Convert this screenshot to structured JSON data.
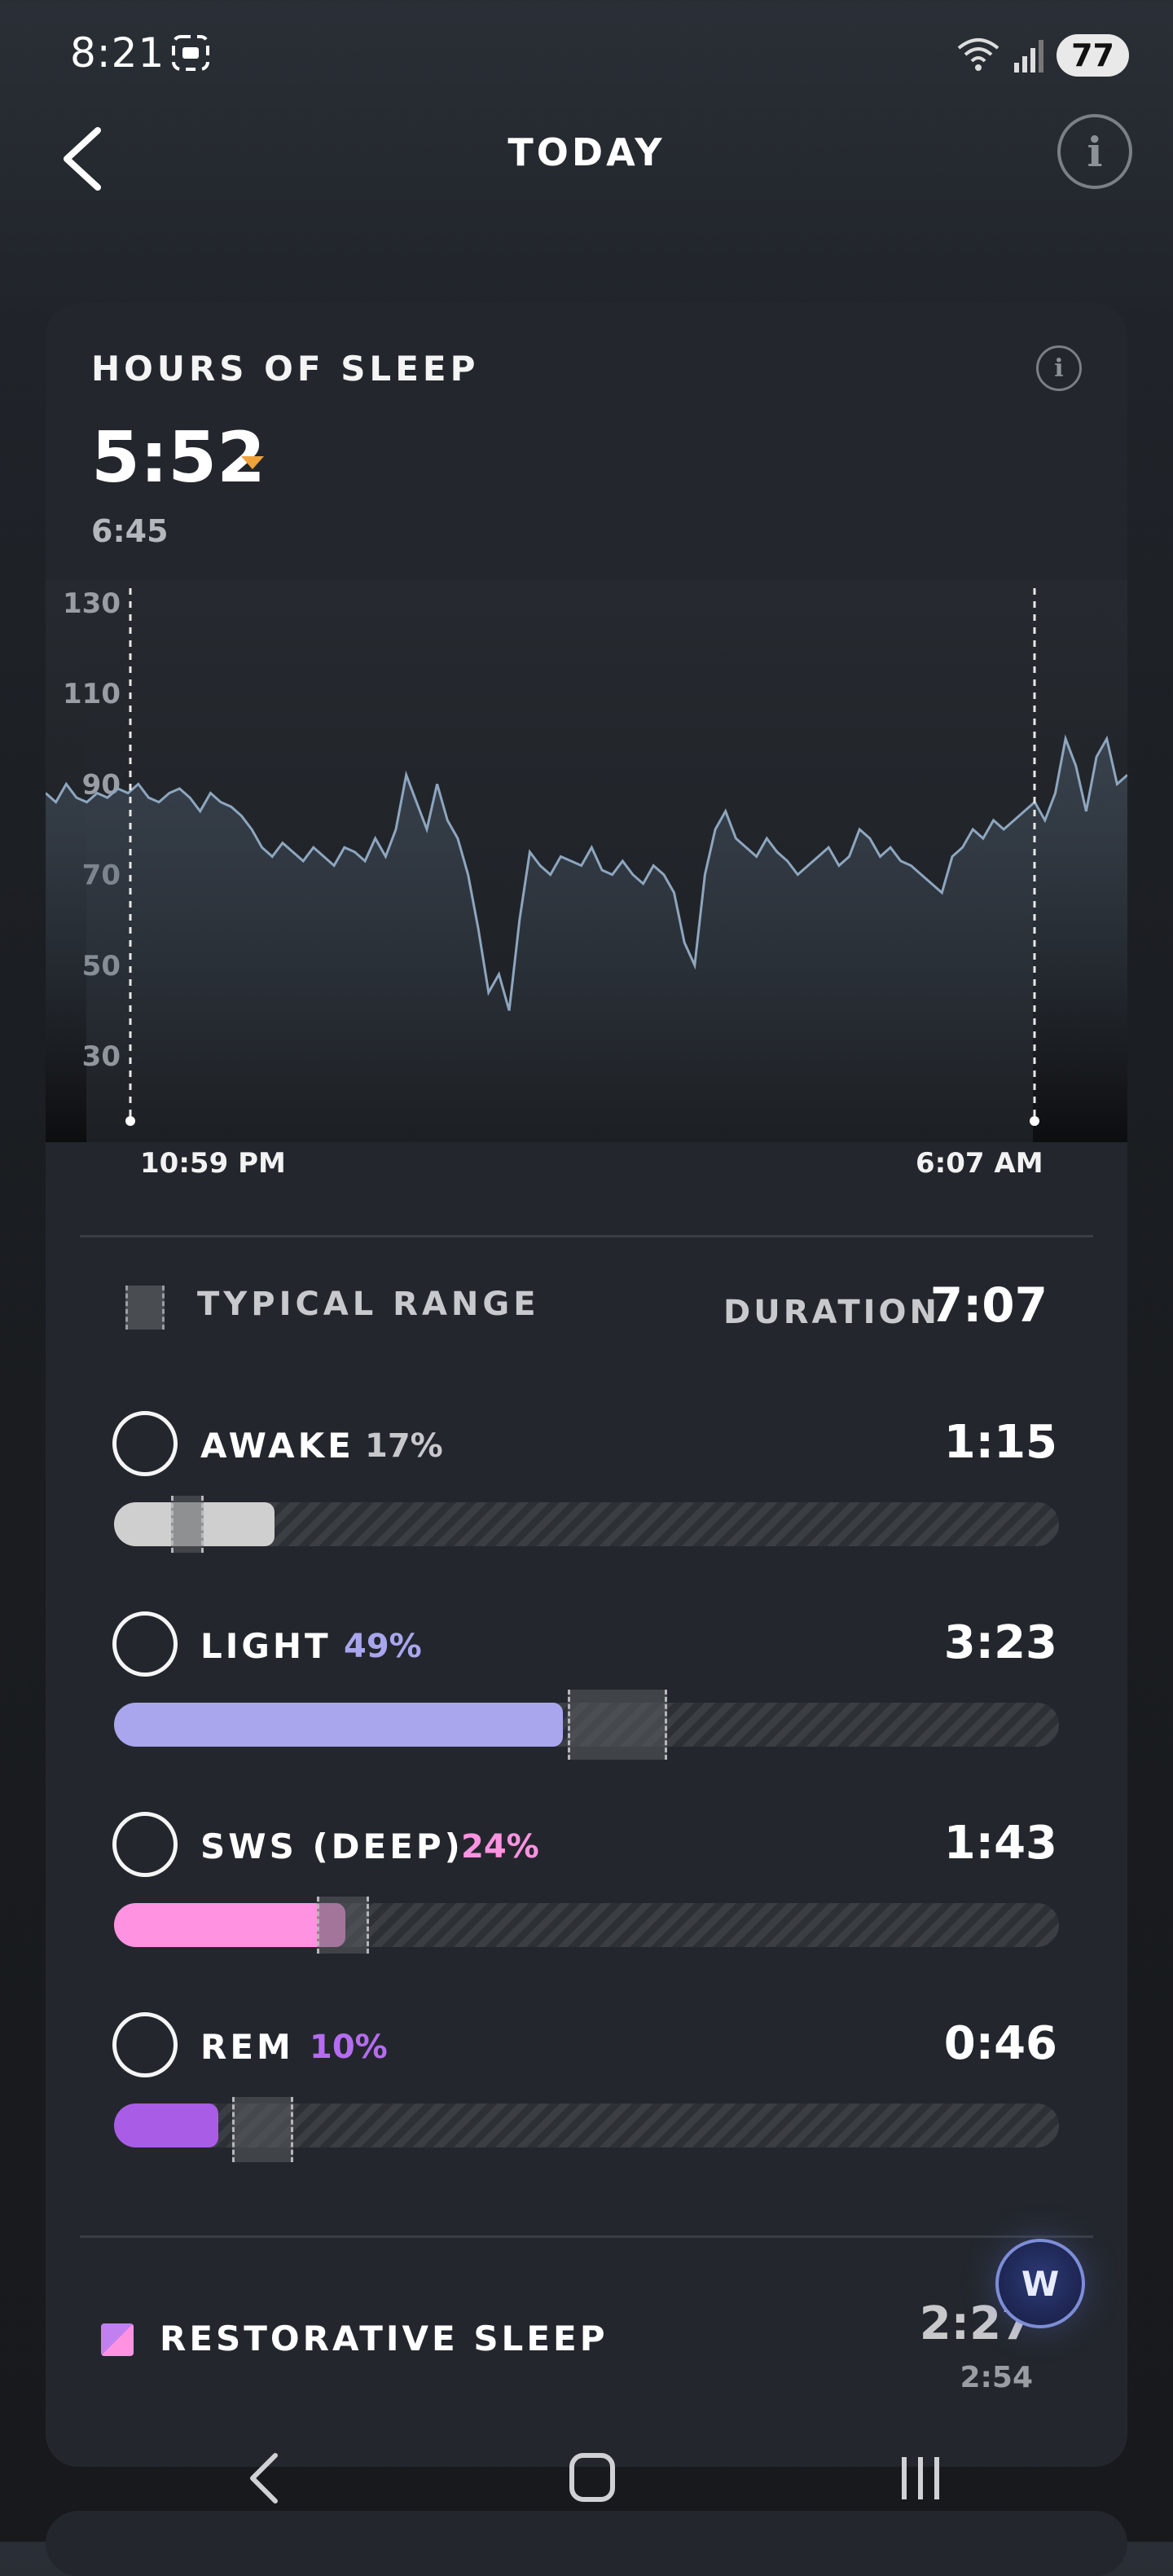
{
  "status_bar": {
    "time": "8:21",
    "battery": "77"
  },
  "header": {
    "title": "TODAY"
  },
  "card": {
    "title": "HOURS OF SLEEP",
    "hours_of_sleep": "5:52",
    "sleep_needed": "6:45",
    "start_time": "10:59 PM",
    "end_time": "6:07 AM"
  },
  "chart_data": {
    "type": "line",
    "y_ticks": [
      "130",
      "110",
      "90",
      "70",
      "50",
      "30"
    ],
    "ylim": [
      30,
      130
    ],
    "x_labels": [
      "10:59 PM",
      "6:07 AM"
    ],
    "series": [
      {
        "values": [
          88,
          86,
          90,
          87,
          86,
          88,
          87,
          89,
          88,
          90,
          87,
          86,
          88,
          89,
          87,
          84,
          88,
          86,
          85,
          83,
          80,
          76,
          74,
          77,
          75,
          73,
          76,
          74,
          72,
          76,
          75,
          73,
          78,
          74,
          80,
          92,
          86,
          80,
          90,
          82,
          78,
          70,
          58,
          44,
          48,
          40,
          60,
          75,
          72,
          70,
          74,
          73,
          72,
          76,
          71,
          70,
          73,
          70,
          68,
          72,
          70,
          66,
          55,
          50,
          70,
          80,
          84,
          78,
          76,
          74,
          78,
          75,
          73,
          70,
          72,
          74,
          76,
          72,
          74,
          80,
          78,
          74,
          76,
          73,
          72,
          70,
          68,
          66,
          74,
          76,
          80,
          78,
          82,
          80,
          82,
          84,
          86,
          82,
          88,
          100,
          94,
          84,
          96,
          100,
          90,
          92
        ]
      }
    ],
    "grid": false
  },
  "legend": {
    "typical_range": "TYPICAL RANGE",
    "duration_label": "DURATION",
    "duration_value": "7:07"
  },
  "stages": [
    {
      "name": "AWAKE",
      "percent": "17%",
      "time": "1:15",
      "pct_color": "#c8c8cc",
      "fill_color": "#cfcfcf",
      "fill": 0.17,
      "range_start": 0.06,
      "range_end": 0.095
    },
    {
      "name": "LIGHT",
      "percent": "49%",
      "time": "3:23",
      "pct_color": "#a9a6ee",
      "fill_color": "#a9a6ee",
      "fill": 0.475,
      "range_start": 0.48,
      "range_end": 0.585
    },
    {
      "name": "SWS (DEEP)",
      "percent": "24%",
      "time": "1:43",
      "pct_color": "#ff93e2",
      "fill_color": "#ff93e2",
      "fill": 0.245,
      "range_start": 0.215,
      "range_end": 0.27
    },
    {
      "name": "REM",
      "percent": "10%",
      "time": "0:46",
      "pct_color": "#b66cf0",
      "fill_color": "#a95ce6",
      "fill": 0.11,
      "range_start": 0.125,
      "range_end": 0.19
    }
  ],
  "restorative": {
    "label": "RESTORATIVE SLEEP",
    "value": "2:27",
    "sub_value": "2:54"
  },
  "fab": {
    "label": "W"
  }
}
